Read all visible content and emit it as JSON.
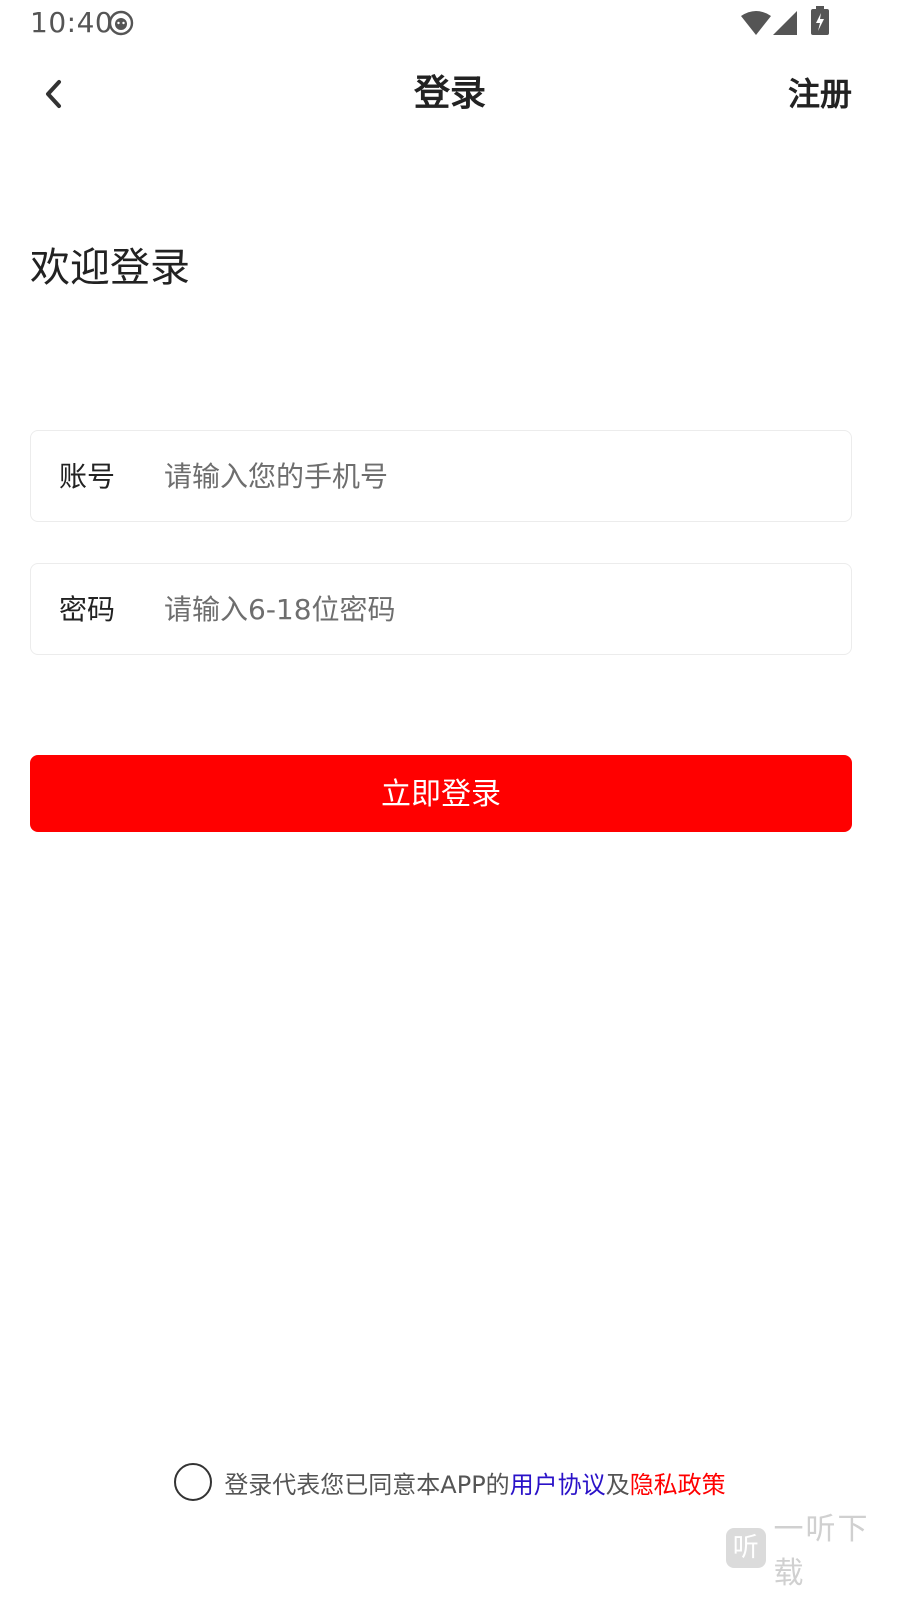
{
  "status_bar": {
    "time": "10:40",
    "icons": [
      "cat-face-icon",
      "wifi-icon",
      "signal-icon",
      "battery-charging-icon"
    ]
  },
  "nav": {
    "back_icon": "chevron-left-icon",
    "title": "登录",
    "register_label": "注册"
  },
  "welcome_text": "欢迎登录",
  "form": {
    "account": {
      "label": "账号",
      "placeholder": "请输入您的手机号",
      "value": ""
    },
    "password": {
      "label": "密码",
      "placeholder": "请输入6-18位密码",
      "value": ""
    }
  },
  "login_button_label": "立即登录",
  "agreement": {
    "checked": false,
    "prefix": "登录代表您已同意本APP的",
    "user_agreement": "用户协议",
    "conjunction": "及",
    "privacy_policy": "隐私政策"
  },
  "watermark": {
    "logo_glyph": "听",
    "text": "一听下载"
  },
  "colors": {
    "primary": "#ff0000",
    "user_agreement_link": "#2a12c8",
    "privacy_link": "#ff0000",
    "field_border": "#ececec",
    "placeholder": "#6e6e6e"
  }
}
